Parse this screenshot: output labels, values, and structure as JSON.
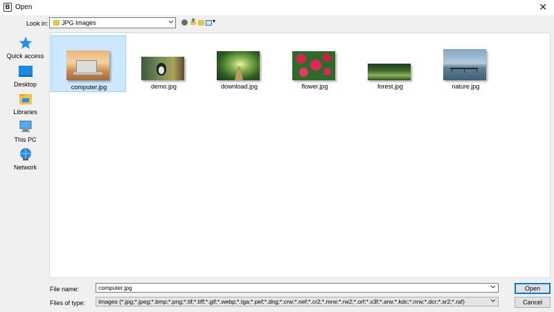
{
  "window": {
    "title": "Open",
    "app_icon_letter": "B",
    "close_glyph": "✕"
  },
  "lookin": {
    "label": "Look in:",
    "value": "JPG Images"
  },
  "places": [
    {
      "label": "Quick access",
      "icon": "star-icon"
    },
    {
      "label": "Desktop",
      "icon": "desktop-icon"
    },
    {
      "label": "Libraries",
      "icon": "libraries-icon"
    },
    {
      "label": "This PC",
      "icon": "this-pc-icon"
    },
    {
      "label": "Network",
      "icon": "network-icon"
    }
  ],
  "files": [
    {
      "name": "computer.jpg",
      "selected": true
    },
    {
      "name": "demo.jpg",
      "selected": false
    },
    {
      "name": "download.jpg",
      "selected": false
    },
    {
      "name": "flower.jpg",
      "selected": false
    },
    {
      "name": "forest.jpg",
      "selected": false
    },
    {
      "name": "nature.jpg",
      "selected": false
    }
  ],
  "filename": {
    "label": "File name:",
    "value": "computer.jpg"
  },
  "filetype": {
    "label": "Files of type:",
    "value": "Images (*.jpg;*.jpeg;*.bmp;*.png;*.tif;*.tiff;*.gif;*.webp;*.tga;*.pef;*.dng;*.crw;*.nef;*.cr2;*.mrw;*.rw2;*.orf;*.x3f;*.arw;*.kdc;*.nrw;*.dcr;*.sr2;*.raf)"
  },
  "buttons": {
    "open": "Open",
    "cancel": "Cancel"
  },
  "colors": {
    "selection_bg": "#cce8ff",
    "selection_border": "#99d1ff",
    "accent": "#0078d7",
    "folder": "#e8c259"
  }
}
